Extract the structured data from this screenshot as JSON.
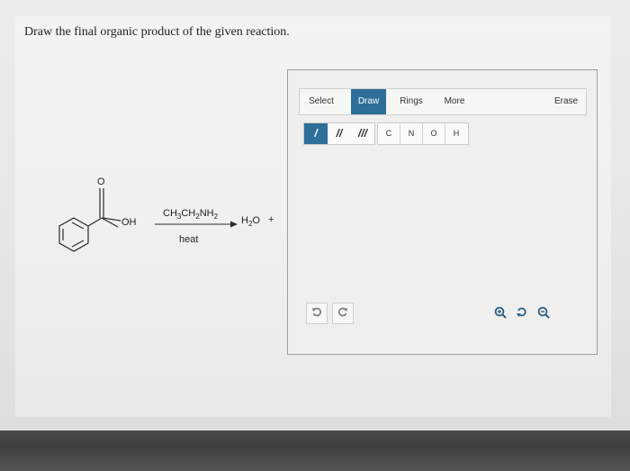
{
  "question": {
    "prompt": "Draw the final organic product of the given reaction."
  },
  "reaction": {
    "oxygen_label": "O",
    "hydroxyl_label": "OH",
    "reagent": {
      "part1": "CH",
      "sub1": "3",
      "part2": "CH",
      "sub2": "2",
      "part3": "NH",
      "sub3": "2"
    },
    "condition": "heat",
    "byproduct": {
      "part1": "H",
      "sub1": "2",
      "part2": "O"
    },
    "plus": "+"
  },
  "editor": {
    "tabs": [
      {
        "label": "Select",
        "active": false
      },
      {
        "label": "Draw",
        "active": true
      },
      {
        "label": "Rings",
        "active": false
      },
      {
        "label": "More",
        "active": false
      },
      {
        "label": "Erase",
        "active": false
      }
    ],
    "bonds": [
      {
        "label": "/",
        "active": true
      },
      {
        "label": "//",
        "active": false
      },
      {
        "label": "///",
        "active": false
      }
    ],
    "atoms": [
      "C",
      "N",
      "O",
      "H"
    ],
    "undo_icon": "undo-icon",
    "redo_icon": "redo-icon",
    "zoom_icons": [
      "zoom-in-icon",
      "reset-zoom-icon",
      "zoom-out-icon"
    ]
  },
  "colors": {
    "accent": "#2e6f99",
    "zoom_icon": "#2a5f85"
  }
}
